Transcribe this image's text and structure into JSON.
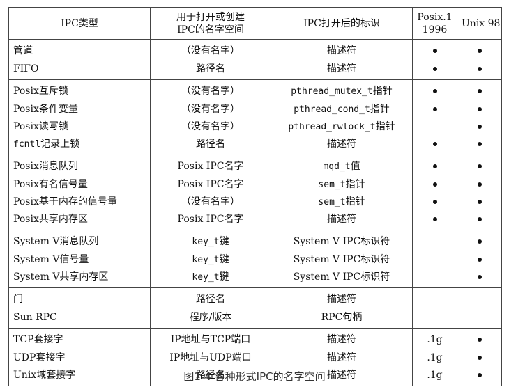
{
  "headers": {
    "type": "IPC类型",
    "name_line1": "用于打开或创建",
    "name_line2": "IPC的名字空间",
    "id": "IPC打开后的标识",
    "posix_line1": "Posix.1",
    "posix_line2": "1996",
    "unix": "Unix 98"
  },
  "groups": [
    {
      "rows": [
        {
          "type": "管道",
          "name": "（没有名字）",
          "id": "描述符",
          "posix": true,
          "unix": true
        },
        {
          "type": "FIFO",
          "name": "路径名",
          "id": "描述符",
          "posix": true,
          "unix": true
        }
      ]
    },
    {
      "rows": [
        {
          "type": "Posix互斥锁",
          "name": "（没有名字）",
          "id_code": "pthread_mutex_t",
          "id_suffix": "指针",
          "posix": true,
          "unix": true
        },
        {
          "type": "Posix条件变量",
          "name": "（没有名字）",
          "id_code": "pthread_cond_t",
          "id_suffix": "指针",
          "posix": true,
          "unix": true
        },
        {
          "type": "Posix读写锁",
          "name": "（没有名字）",
          "id_code": "pthread_rwlock_t",
          "id_suffix": "指针",
          "posix": false,
          "unix": true
        },
        {
          "type_code": "fcntl",
          "type_suffix": "记录上锁",
          "name": "路径名",
          "id": "描述符",
          "posix": true,
          "unix": true
        }
      ]
    },
    {
      "rows": [
        {
          "type": "Posix消息队列",
          "name": "Posix IPC名字",
          "id_code": "mqd_t",
          "id_suffix": "值",
          "posix": true,
          "unix": true
        },
        {
          "type": "Posix有名信号量",
          "name": "Posix IPC名字",
          "id_code": "sem_t",
          "id_suffix": "指针",
          "posix": true,
          "unix": true
        },
        {
          "type": "Posix基于内存的信号量",
          "name": "（没有名字）",
          "id_code": "sem_t",
          "id_suffix": "指针",
          "posix": true,
          "unix": true
        },
        {
          "type": "Posix共享内存区",
          "name": "Posix IPC名字",
          "id": "描述符",
          "posix": true,
          "unix": true
        }
      ]
    },
    {
      "rows": [
        {
          "type": "System V消息队列",
          "name_code": "key_t",
          "name_suffix": "键",
          "id": "System V IPC标识符",
          "posix": false,
          "unix": true
        },
        {
          "type": "System V信号量",
          "name_code": "key_t",
          "name_suffix": "键",
          "id": "System V IPC标识符",
          "posix": false,
          "unix": true
        },
        {
          "type": "System V共享内存区",
          "name_code": "key_t",
          "name_suffix": "键",
          "id": "System V IPC标识符",
          "posix": false,
          "unix": true
        }
      ]
    },
    {
      "rows": [
        {
          "type": "门",
          "name": "路径名",
          "id": "描述符",
          "posix": false,
          "unix": false
        },
        {
          "type": "Sun RPC",
          "name": "程序/版本",
          "id": "RPC句柄",
          "posix": false,
          "unix": false
        }
      ]
    },
    {
      "rows": [
        {
          "type": "TCP套接字",
          "name": "IP地址与TCP端口",
          "id": "描述符",
          "posix_text": ".1g",
          "unix": true
        },
        {
          "type": "UDP套接字",
          "name": "IP地址与UDP端口",
          "id": "描述符",
          "posix_text": ".1g",
          "unix": true
        },
        {
          "type": "Unix域套接字",
          "name": "路径名",
          "id": "描述符",
          "posix_text": ".1g",
          "unix": true
        }
      ]
    }
  ],
  "caption": "图1-4 各种形式IPC的名字空间",
  "colors": {
    "text": "#111111",
    "border": "#444444",
    "caption": "#333333"
  }
}
